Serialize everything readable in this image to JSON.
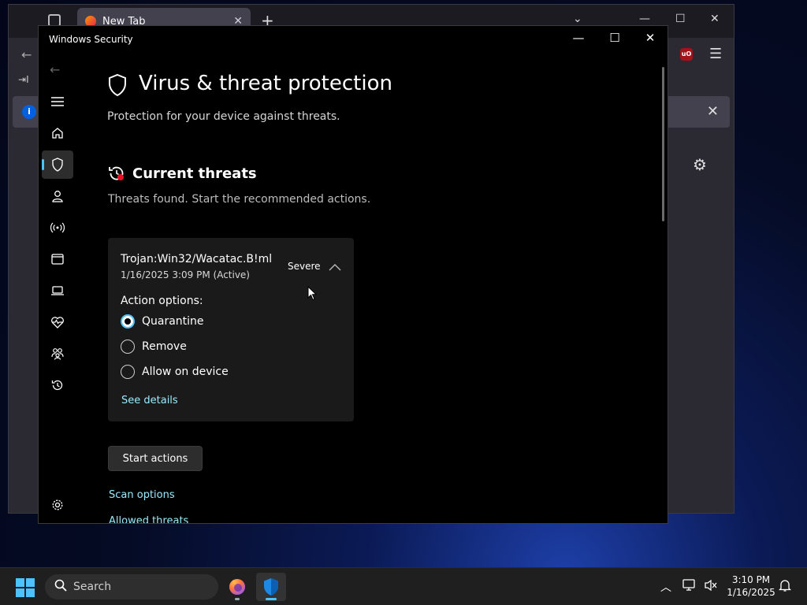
{
  "browser": {
    "tab_title": "New Tab",
    "tab_close": "✕",
    "new_tab": "+",
    "import_label": "I"
  },
  "window": {
    "title": "Windows Security",
    "minimize": "—",
    "maximize": "☐",
    "close": "✕"
  },
  "page": {
    "title": "Virus & threat protection",
    "subtitle": "Protection for your device against threats."
  },
  "current_threats": {
    "title": "Current threats",
    "subtitle": "Threats found. Start the recommended actions.",
    "threat": {
      "name": "Trojan:Win32/Wacatac.B!ml",
      "time": "1/16/2025 3:09 PM (Active)",
      "severity": "Severe",
      "action_label": "Action options:",
      "options": [
        "Quarantine",
        "Remove",
        "Allow on device"
      ],
      "selected": "Quarantine",
      "details_link": "See details"
    },
    "start_button": "Start actions"
  },
  "links": {
    "scan_options": "Scan options",
    "allowed_threats": "Allowed threats"
  },
  "nav_icons": [
    "menu-icon",
    "home-icon",
    "shield-icon",
    "account-icon",
    "firewall-icon",
    "app-browser-icon",
    "device-security-icon",
    "health-icon",
    "family-icon",
    "history-icon",
    "settings-icon"
  ],
  "taskbar": {
    "search_placeholder": "Search",
    "time": "3:10 PM",
    "date": "1/16/2025"
  },
  "colors": {
    "accent": "#4cc2ff",
    "link": "#99ebff",
    "window_bg": "#000000",
    "card_bg": "#1a1a1a"
  }
}
